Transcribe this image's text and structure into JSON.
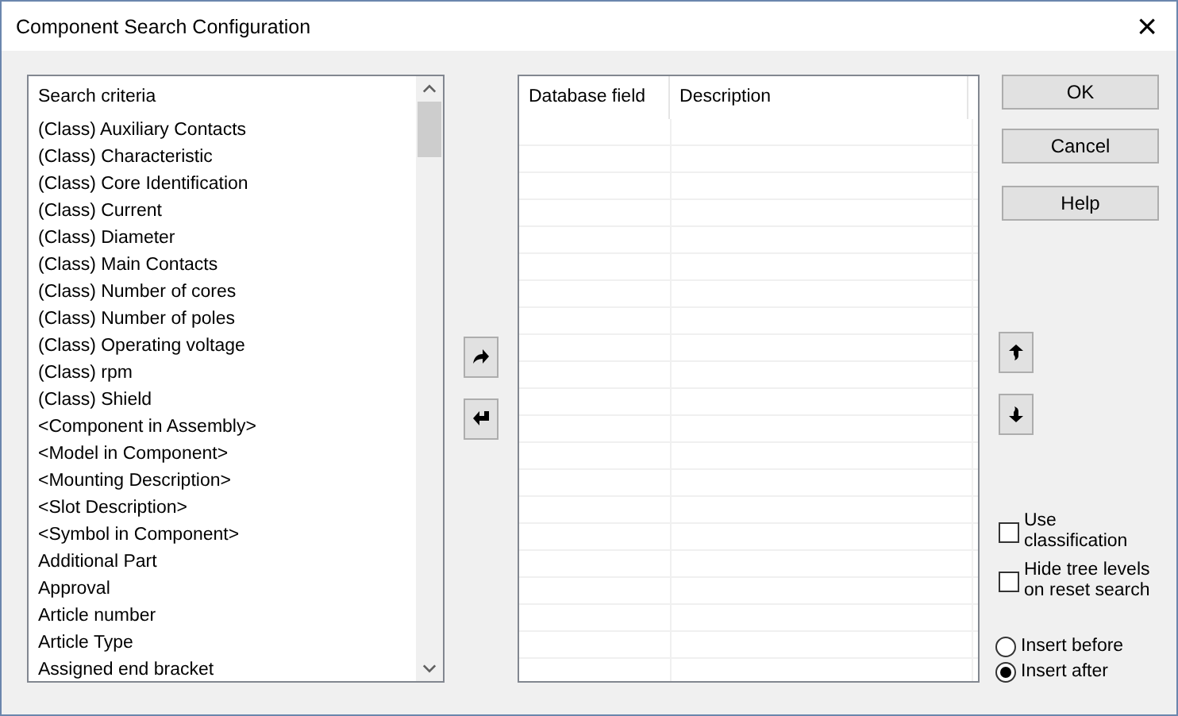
{
  "window": {
    "title": "Component Search Configuration",
    "close": "×"
  },
  "criteria_list": {
    "header": "Search criteria",
    "items": [
      {
        "label": "(Class) Auxiliary Contacts"
      },
      {
        "label": "(Class) Characteristic"
      },
      {
        "label": "(Class) Core Identification"
      },
      {
        "label": "(Class) Current"
      },
      {
        "label": "(Class) Diameter"
      },
      {
        "label": "(Class) Main Contacts"
      },
      {
        "label": "(Class) Number of cores"
      },
      {
        "label": "(Class) Number of poles"
      },
      {
        "label": "(Class) Operating voltage"
      },
      {
        "label": "(Class) rpm"
      },
      {
        "label": "(Class) Shield"
      },
      {
        "label": "<Component in Assembly>"
      },
      {
        "label": "<Model in Component>"
      },
      {
        "label": "<Mounting Description>"
      },
      {
        "label": "<Slot Description>"
      },
      {
        "label": "<Symbol in Component>"
      },
      {
        "label": "Additional Part"
      },
      {
        "label": "Approval"
      },
      {
        "label": "Article number"
      },
      {
        "label": "Article Type"
      },
      {
        "label": "Assigned end bracket"
      }
    ]
  },
  "fields_table": {
    "columns": [
      "Database field",
      "Description"
    ]
  },
  "buttons": [
    "OK",
    "Cancel",
    "Help"
  ],
  "options": [
    {
      "label": "Use classification",
      "checked": false
    },
    {
      "label": "Hide tree levels on reset search",
      "checked": false
    }
  ],
  "insert_position": [
    {
      "label": "Insert before",
      "selected": false
    },
    {
      "label": "Insert after",
      "selected": true
    }
  ]
}
